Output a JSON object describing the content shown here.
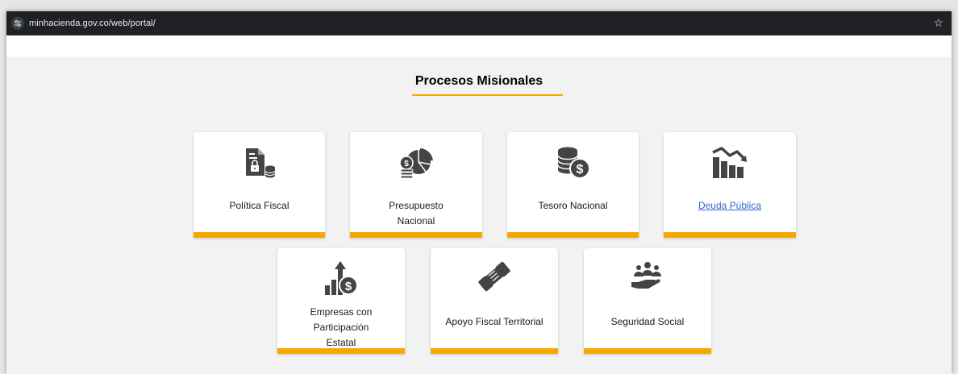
{
  "browser": {
    "url": "minhacienda.gov.co/web/portal/",
    "site_icon": "tune-icon",
    "bookmark_icon": "star-icon"
  },
  "section": {
    "title": "Procesos Misionales",
    "accent_color": "#f5a800"
  },
  "cards": [
    {
      "label": "Política Fiscal",
      "icon": "document-lock-coins-icon"
    },
    {
      "label": "Presupuesto Nacional",
      "icon": "coins-pie-chart-icon"
    },
    {
      "label": "Tesoro Nacional",
      "icon": "coin-stack-dollar-icon"
    },
    {
      "label": "Deuda Pública",
      "icon": "bar-chart-down-trend-icon",
      "link": true
    },
    {
      "label": "Empresas con Participación Estatal",
      "icon": "bars-arrow-up-dollar-icon"
    },
    {
      "label": "Apoyo Fiscal Territorial",
      "icon": "handshake-icon"
    },
    {
      "label": "Seguridad Social",
      "icon": "people-hand-icon"
    }
  ]
}
